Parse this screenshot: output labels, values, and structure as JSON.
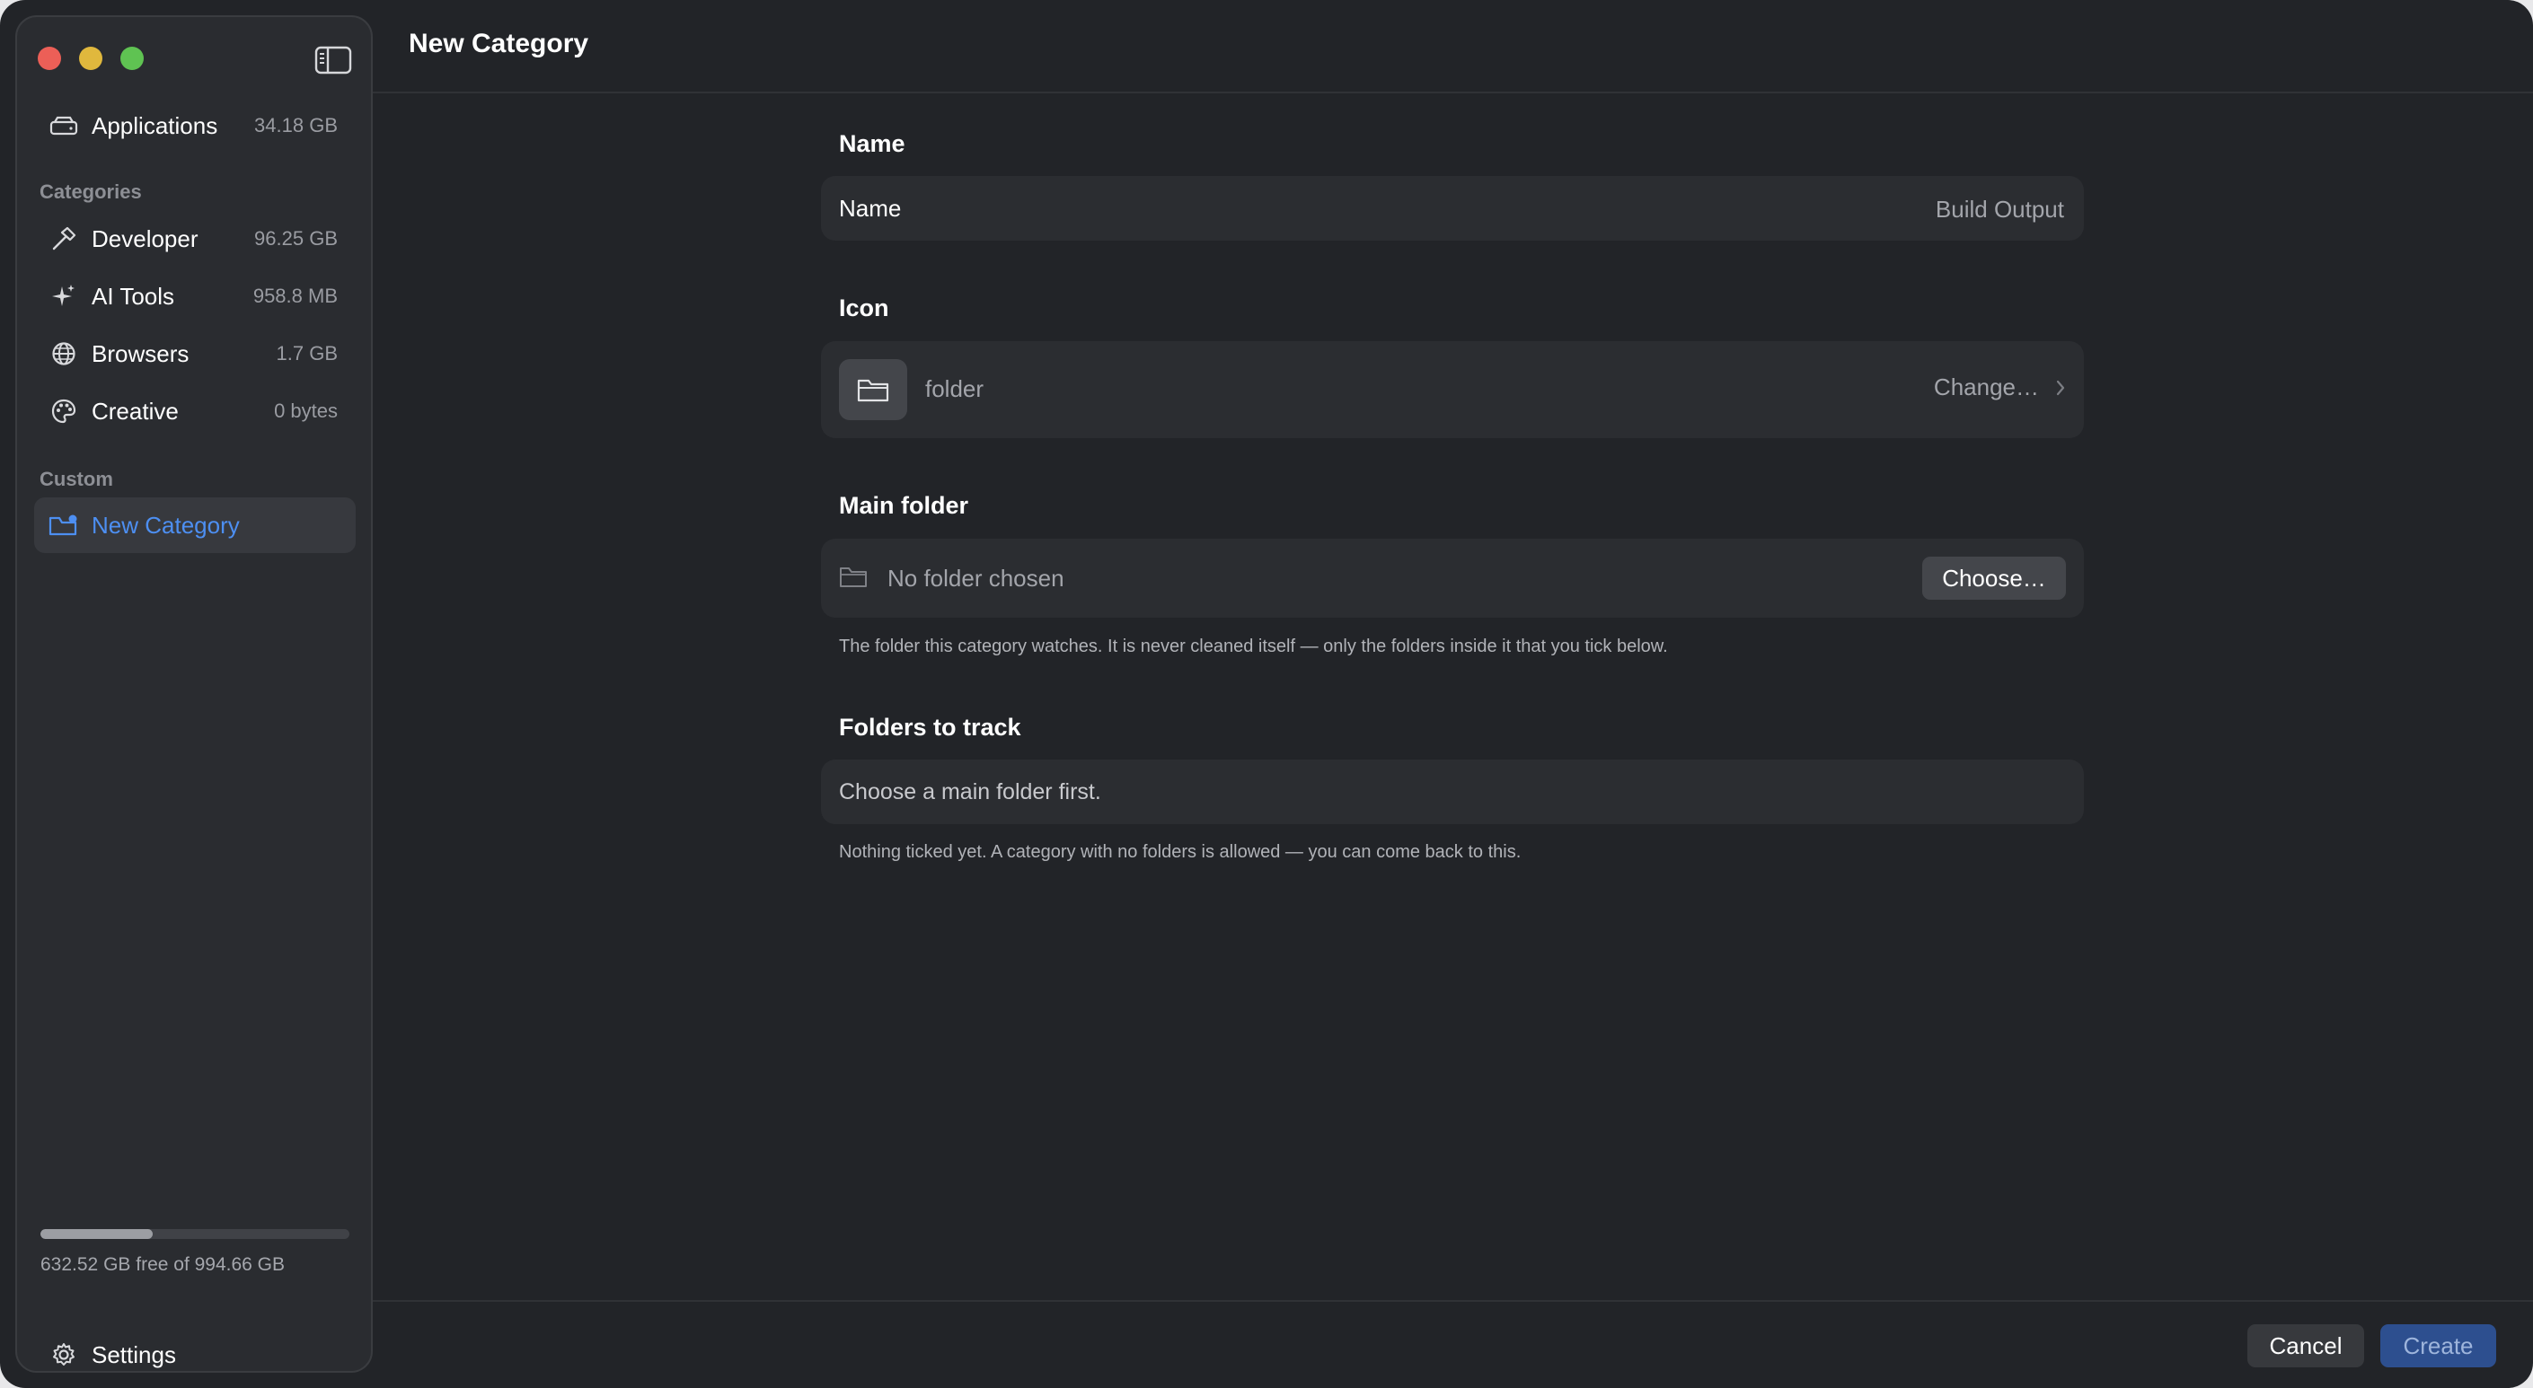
{
  "window": {
    "title": "New Category"
  },
  "sidebar": {
    "applications": {
      "label": "Applications",
      "size": "34.18 GB",
      "icon": "drive-icon"
    },
    "categories_heading": "Categories",
    "categories": [
      {
        "label": "Developer",
        "size": "96.25 GB",
        "icon": "hammer-icon"
      },
      {
        "label": "AI Tools",
        "size": "958.8 MB",
        "icon": "sparkles-icon"
      },
      {
        "label": "Browsers",
        "size": "1.7 GB",
        "icon": "globe-icon"
      },
      {
        "label": "Creative",
        "size": "0 bytes",
        "icon": "palette-icon"
      }
    ],
    "custom_heading": "Custom",
    "custom": [
      {
        "label": "New Category",
        "icon": "folder-badge-icon",
        "selected": true
      }
    ],
    "storage": {
      "text": "632.52 GB  free of 994.66 GB",
      "used_fraction": 0.364
    },
    "settings_label": "Settings"
  },
  "form": {
    "name_section": "Name",
    "name_label": "Name",
    "name_placeholder": "Build Output",
    "name_value": "",
    "icon_section": "Icon",
    "icon_name": "folder",
    "icon_change": "Change…",
    "main_folder_section": "Main folder",
    "main_folder_value": "No folder chosen",
    "choose_label": "Choose…",
    "main_folder_help": "The folder this category watches. It is never cleaned itself — only the folders inside it that you tick below.",
    "track_section": "Folders to track",
    "track_message": "Choose a main folder first.",
    "track_help": "Nothing ticked yet. A category with no folders is allowed — you can come back to this."
  },
  "footer": {
    "cancel_label": "Cancel",
    "create_label": "Create"
  },
  "colors": {
    "accent": "#4d8ff2",
    "primary_button": "#2d4f8f"
  }
}
